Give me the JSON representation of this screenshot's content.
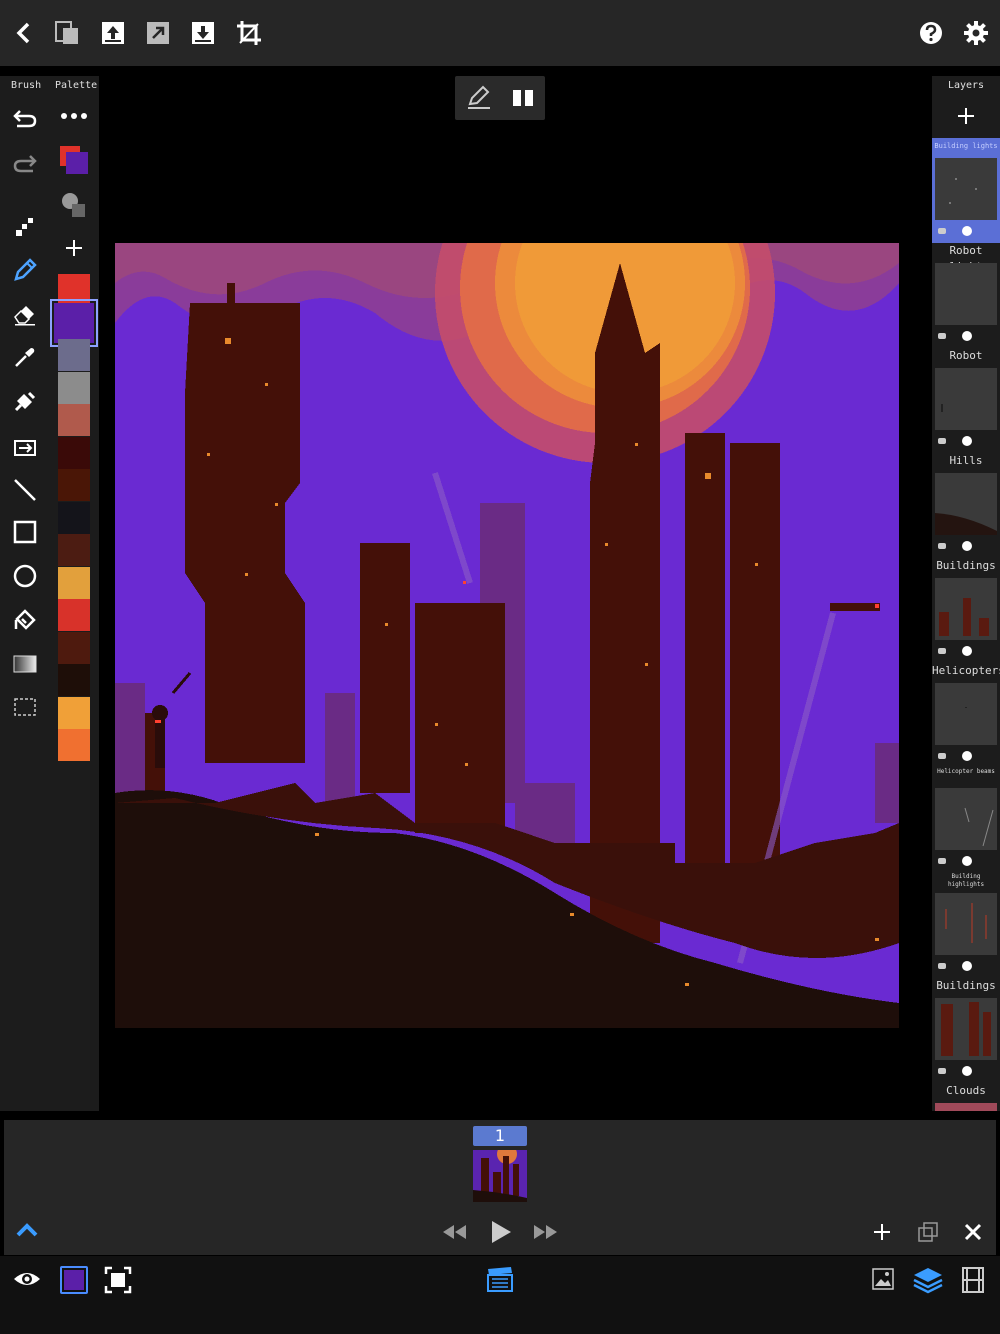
{
  "left_panel": {
    "brush_label": "Brush",
    "palette_label": "Palette"
  },
  "layers": {
    "header": "Layers",
    "items": [
      {
        "name": "Building lights",
        "active": true
      },
      {
        "name": "Robot light"
      },
      {
        "name": "Robot"
      },
      {
        "name": "Hills"
      },
      {
        "name": "Buildings"
      },
      {
        "name": "Helicopters"
      },
      {
        "name": "Helicopter beams"
      },
      {
        "name": "Building highlights"
      },
      {
        "name": "Buildings"
      },
      {
        "name": "Clouds"
      }
    ]
  },
  "palette": {
    "primary_color": "#5b1fa8",
    "secondary_color": "#e0322a",
    "swatches": [
      "#e0322a",
      "#5b1fa8",
      "#6c6c8c",
      "#8c8c8c",
      "#b05a4c",
      "#3a0a08",
      "#4a1606",
      "#14141a",
      "#4c1c12",
      "#e2a03c",
      "#d8322a",
      "#4e1a0e",
      "#1e0e08",
      "#f0a038",
      "#f07030"
    ]
  },
  "timeline": {
    "frame_number": "1"
  }
}
